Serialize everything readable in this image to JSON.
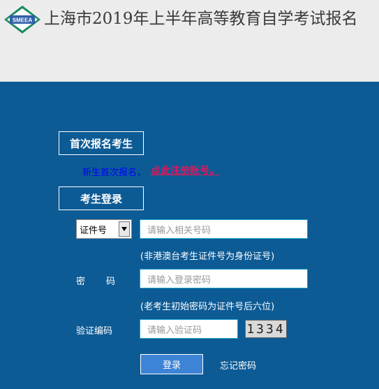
{
  "header": {
    "logo_text": "SMEEA",
    "title": "上海市2019年上半年高等教育自学考试报名"
  },
  "first_registration": {
    "section_title": "首次报名考生",
    "new_user_text": "新生首次报名，",
    "register_link": "点此注册账号。"
  },
  "login": {
    "section_title": "考生登录",
    "id_type_selected": "证件号",
    "id_placeholder": "请输入相关号码",
    "id_hint": "(非港澳台考生证件号为身份证号)",
    "password_label": "密码",
    "password_placeholder": "请输入登录密码",
    "password_hint": "(老考生初始密码为证件号后六位)",
    "captcha_label": "验证编码",
    "captcha_placeholder": "请输入验证码",
    "captcha_text": "1334",
    "login_button": "登录",
    "forgot_password": "忘记密码"
  },
  "colors": {
    "background": "#0d5b95",
    "header": "#ececec",
    "link": "#d81b5d",
    "button": "#3e84d6"
  }
}
